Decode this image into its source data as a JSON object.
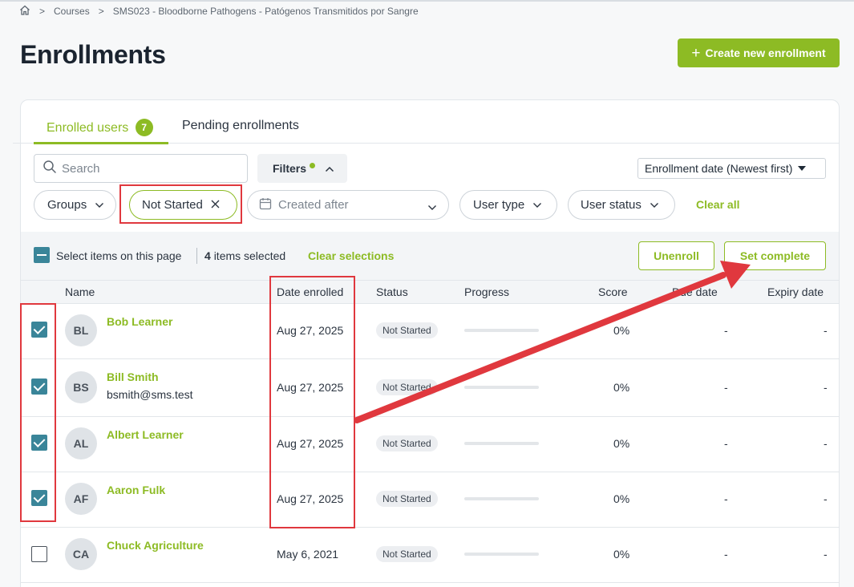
{
  "breadcrumb": {
    "items": [
      "Courses",
      "SMS023 - Bloodborne Pathogens - Patógenos Transmitidos por Sangre"
    ]
  },
  "page": {
    "title": "Enrollments",
    "create_button": "Create new enrollment"
  },
  "tabs": {
    "enrolled_label": "Enrolled users",
    "enrolled_count": "7",
    "pending_label": "Pending enrollments"
  },
  "toolbar": {
    "search_placeholder": "Search",
    "filters_label": "Filters",
    "sort_label": "Enrollment date (Newest first)"
  },
  "filters": {
    "groups": "Groups",
    "active_status": "Not Started",
    "created_after_placeholder": "Created after",
    "user_type": "User type",
    "user_status": "User status",
    "clear_all": "Clear all"
  },
  "selection": {
    "select_label": "Select items on this page",
    "count": "4",
    "count_suffix": "items selected",
    "clear_label": "Clear selections",
    "unenroll_label": "Unenroll",
    "set_complete_label": "Set complete"
  },
  "table": {
    "headers": {
      "name": "Name",
      "date_enrolled": "Date enrolled",
      "status": "Status",
      "progress": "Progress",
      "score": "Score",
      "due_date": "Due date",
      "expiry_date": "Expiry date"
    },
    "rows": [
      {
        "initials": "BL",
        "name": "Bob Learner",
        "email": "",
        "date": "Aug 27, 2025",
        "status": "Not Started",
        "progress": 0,
        "score": "0%",
        "due": "-",
        "expiry": "-",
        "checked": true
      },
      {
        "initials": "BS",
        "name": "Bill Smith",
        "email": "bsmith@sms.test",
        "date": "Aug 27, 2025",
        "status": "Not Started",
        "progress": 0,
        "score": "0%",
        "due": "-",
        "expiry": "-",
        "checked": true
      },
      {
        "initials": "AL",
        "name": "Albert Learner",
        "email": "",
        "date": "Aug 27, 2025",
        "status": "Not Started",
        "progress": 0,
        "score": "0%",
        "due": "-",
        "expiry": "-",
        "checked": true
      },
      {
        "initials": "AF",
        "name": "Aaron Fulk",
        "email": "",
        "date": "Aug 27, 2025",
        "status": "Not Started",
        "progress": 0,
        "score": "0%",
        "due": "-",
        "expiry": "-",
        "checked": true
      },
      {
        "initials": "CA",
        "name": "Chuck Agriculture",
        "email": "",
        "date": "May 6, 2021",
        "status": "Not Started",
        "progress": 0,
        "score": "0%",
        "due": "-",
        "expiry": "-",
        "checked": false
      }
    ]
  },
  "colors": {
    "accent": "#8dbb24",
    "checkbox": "#3a8599",
    "annotation": "#e0383e"
  }
}
